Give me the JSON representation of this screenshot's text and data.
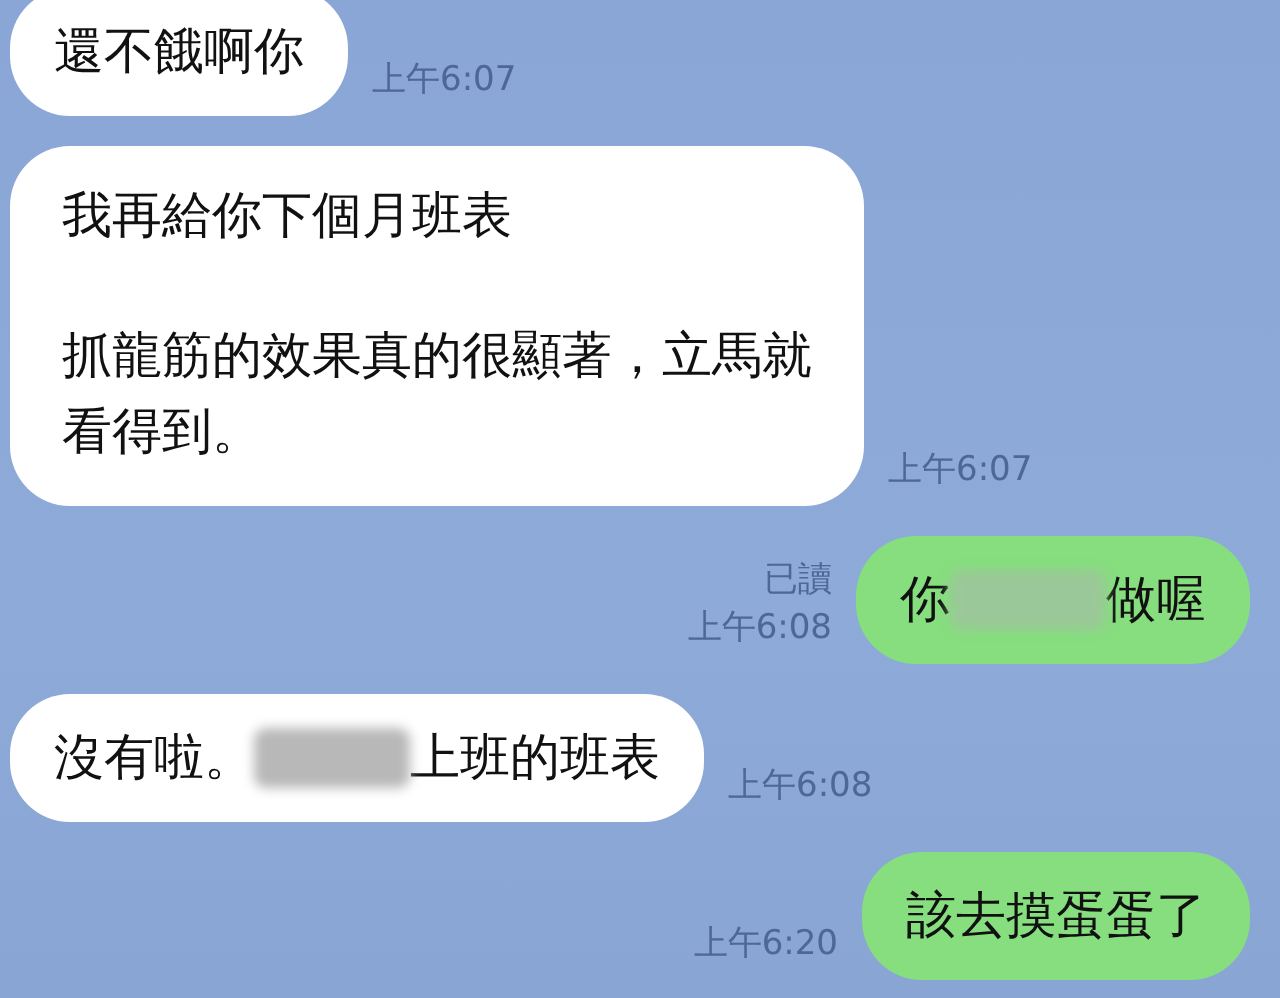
{
  "messages": [
    {
      "kind": "incoming",
      "paragraphs": [
        [
          [
            {
              "kind": "text",
              "text": "還不餓啊你"
            }
          ]
        ]
      ],
      "time": "上午6:07"
    },
    {
      "kind": "incoming",
      "paragraphs": [
        [
          [
            {
              "kind": "text",
              "text": "我再給你下個月班表"
            }
          ]
        ],
        [
          [
            {
              "kind": "text",
              "text": "抓龍筋的效果真的很顯著，立馬就"
            }
          ],
          [
            {
              "kind": "text",
              "text": "看得到。"
            }
          ]
        ]
      ],
      "time": "上午6:07"
    },
    {
      "kind": "outgoing",
      "paragraphs": [
        [
          [
            {
              "kind": "text",
              "text": "你"
            },
            {
              "kind": "blur"
            },
            {
              "kind": "text",
              "text": "做喔"
            }
          ]
        ]
      ],
      "read": "已讀",
      "time": "上午6:08"
    },
    {
      "kind": "incoming",
      "paragraphs": [
        [
          [
            {
              "kind": "text",
              "text": "沒有啦。"
            },
            {
              "kind": "blur"
            },
            {
              "kind": "text",
              "text": "上班的班表"
            }
          ]
        ]
      ],
      "time": "上午6:08"
    },
    {
      "kind": "outgoing",
      "paragraphs": [
        [
          [
            {
              "kind": "text",
              "text": "該去摸蛋蛋了"
            }
          ]
        ]
      ],
      "time": "上午6:20"
    }
  ]
}
